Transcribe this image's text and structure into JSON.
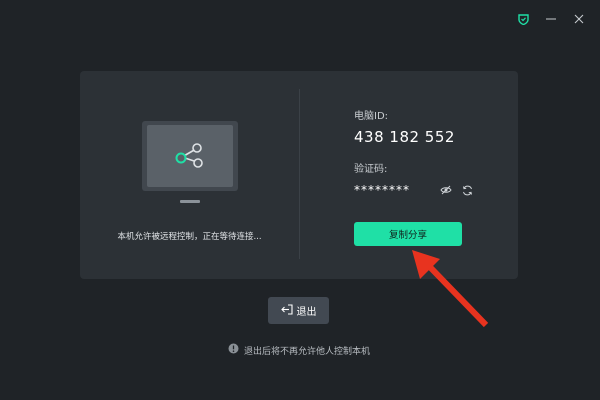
{
  "window": {
    "controls": [
      "pin-icon",
      "minimize-icon",
      "close-icon"
    ]
  },
  "left_panel": {
    "status_text": "本机允许被远程控制，正在等待连接..."
  },
  "right_panel": {
    "device_id_label": "电脑ID:",
    "device_id": "438 182 552",
    "code_label": "验证码:",
    "code_masked": "********",
    "share_button": "复制分享"
  },
  "exit_button": {
    "label": "退出"
  },
  "notice": {
    "text": "退出后将不再允许他人控制本机"
  },
  "colors": {
    "background": "#1f2327",
    "card": "#2c3136",
    "accent": "#1fe0a6",
    "arrow": "#e8331f"
  }
}
